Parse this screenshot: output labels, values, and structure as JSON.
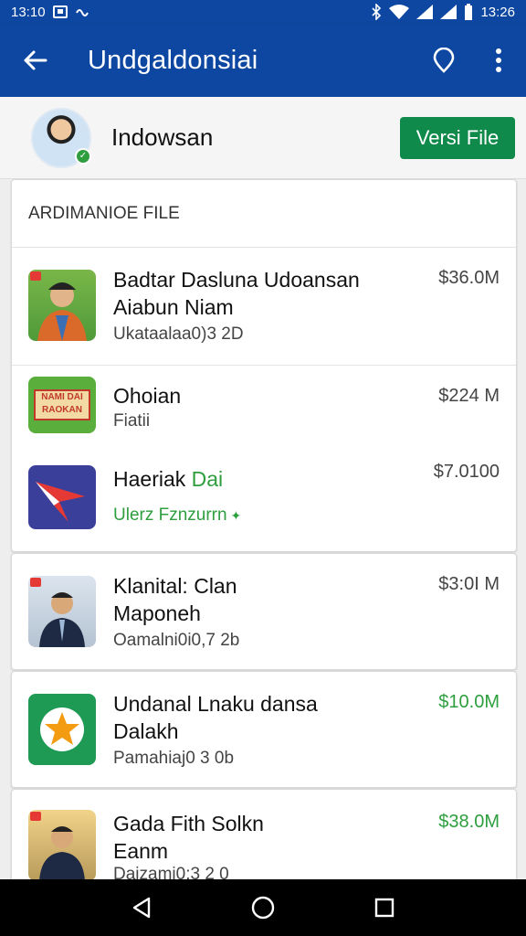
{
  "status_bar": {
    "time_left": "13:10",
    "time_right": "13:26"
  },
  "app_bar": {
    "title": "Undgaldonsiai"
  },
  "profile": {
    "name": "Indowsan",
    "button_label": "Versi File"
  },
  "section": {
    "title": "ARDIMANIOE FILE"
  },
  "items": [
    {
      "title_line1": "Badtar Dasluna Udoansan",
      "title_line2": "Aiabun Niam",
      "subtitle": "Ukataalaa0)3 2D",
      "price": "$36.0M"
    },
    {
      "title_line1": "Ohoian",
      "subtitle": "Fiatii",
      "price": "$224 M",
      "thumb_text_top": "NAMI DAI",
      "thumb_text_bottom": "RAOKAN"
    },
    {
      "title_prefix": "Haeriak",
      "title_suffix": "Dai",
      "subtitle": "Ulerz Fznzurrn",
      "price": "$7.0100"
    },
    {
      "title_line1": "Klanital: Clan",
      "title_line2": "Maponeh",
      "subtitle": "Oamalni0i0,7 2b",
      "price": "$3:0I M"
    },
    {
      "title_line1": "Undanal Lnaku dansa",
      "title_line2": "Dalakh",
      "subtitle": "Pamahiaj0 3 0b",
      "price": "$10.0M"
    },
    {
      "title_line1": "Gada Fith Solkn",
      "title_line2": "Eanm",
      "subtitle": "Daizami0:3 2 0",
      "price": "$38.0M"
    }
  ],
  "colors": {
    "primary": "#0d47a1",
    "accent_green": "#0f8a4b",
    "price_green": "#2e9e3e"
  }
}
